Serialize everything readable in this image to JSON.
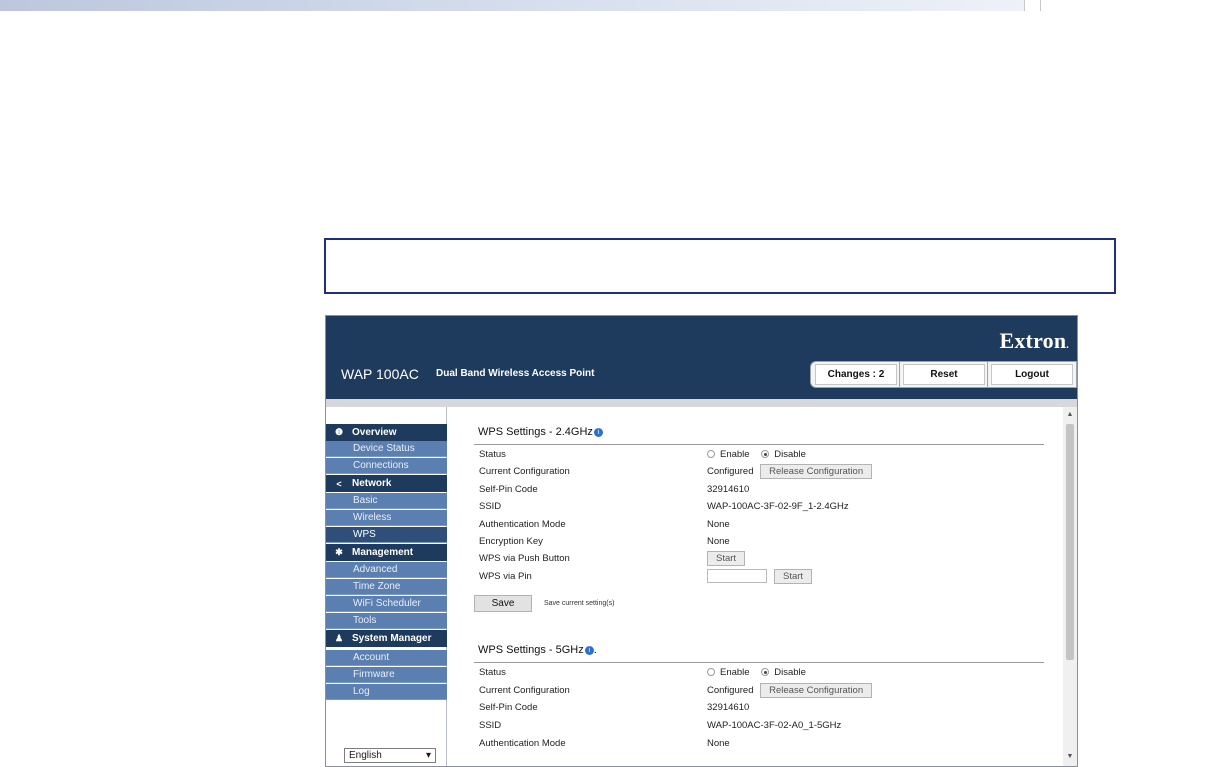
{
  "colors": {
    "header": "#1e3a5c",
    "nav_item": "#5b7fb0",
    "nav_active": "#2f4f7a",
    "note_border": "#1f2f7a",
    "info": "#2b6fd1"
  },
  "header": {
    "brand": "Extron",
    "brand_mark": ".",
    "model": "WAP 100AC",
    "subtitle": "Dual Band Wireless Access Point",
    "changes": "Changes : 2",
    "reset": "Reset",
    "logout": "Logout"
  },
  "sidebar": {
    "sections": [
      {
        "title": "Overview",
        "icon": "info-circle-icon",
        "glyph": "❶",
        "items": [
          "Device Status",
          "Connections"
        ]
      },
      {
        "title": "Network",
        "icon": "share-icon",
        "glyph": "<",
        "items": [
          "Basic",
          "Wireless",
          "WPS"
        ]
      },
      {
        "title": "Management",
        "icon": "gear-icon",
        "glyph": "✱",
        "items": [
          "Advanced",
          "Time Zone",
          "WiFi Scheduler",
          "Tools"
        ]
      },
      {
        "title": "System Manager",
        "icon": "user-icon",
        "glyph": "♟",
        "items": [
          "Account",
          "Firmware",
          "Log"
        ]
      }
    ],
    "active_item": "WPS",
    "language": "English",
    "language_caret": "▾"
  },
  "wps24": {
    "title": "WPS Settings - 2.4GHz",
    "info_glyph": "i",
    "rows": {
      "status": "Status",
      "current_configuration": "Current Configuration",
      "self_pin_code": "Self-Pin Code",
      "ssid": "SSID",
      "authentication_mode": "Authentication Mode",
      "encryption_key": "Encryption Key",
      "wps_push_button": "WPS via Push Button",
      "wps_pin": "WPS via Pin"
    },
    "values": {
      "enable": "Enable",
      "disable": "Disable",
      "selected": "Disable",
      "configured": "Configured",
      "release": "Release Configuration",
      "pin": "32914610",
      "ssid": "WAP-100AC-3F-02-9F_1-2.4GHz",
      "auth": "None",
      "enc": "None",
      "start": "Start",
      "pin_input": ""
    },
    "save": "Save",
    "save_hint": "Save current setting(s)"
  },
  "wps5": {
    "title": "WPS Settings - 5GHz",
    "info_glyph": "i",
    "title_suffix": ".",
    "rows": {
      "status": "Status",
      "current_configuration": "Current Configuration",
      "self_pin_code": "Self-Pin Code",
      "ssid": "SSID",
      "authentication_mode": "Authentication Mode"
    },
    "values": {
      "enable": "Enable",
      "disable": "Disable",
      "selected": "Disable",
      "configured": "Configured",
      "release": "Release Configuration",
      "pin": "32914610",
      "ssid": "WAP-100AC-3F-02-A0_1-5GHz",
      "auth": "None"
    }
  },
  "scrollbar": {
    "up": "▲",
    "down": "▼"
  }
}
